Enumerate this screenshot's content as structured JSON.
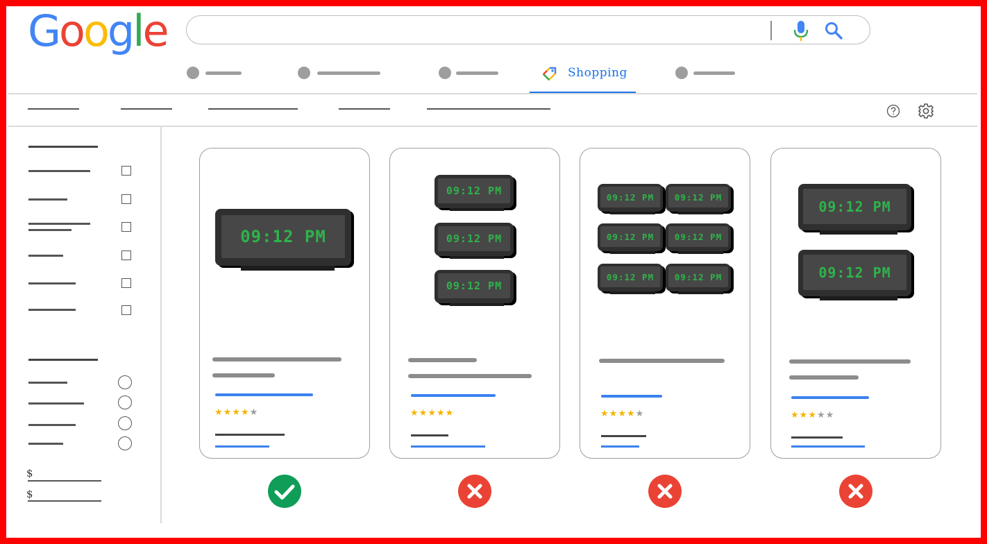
{
  "logo": {
    "text": "Google",
    "letters": [
      "G",
      "o",
      "o",
      "g",
      "l",
      "e"
    ],
    "colors": [
      "#4285F4",
      "#EA4335",
      "#FBBC05",
      "#4285F4",
      "#34A853",
      "#EA4335"
    ]
  },
  "search": {
    "value": "",
    "placeholder": "",
    "mic_icon": "mic-icon",
    "search_icon": "search-icon"
  },
  "tabs": {
    "active": {
      "label": "Shopping",
      "icon": "price-tag-icon"
    }
  },
  "toolbar": {
    "help_icon": "help-icon",
    "settings_icon": "settings-gear-icon"
  },
  "sidebar": {
    "price_symbols": [
      "$",
      "$"
    ]
  },
  "products": [
    {
      "clock_text": "09:12 PM",
      "clock_count": 1,
      "rating": 4,
      "verdict": "correct"
    },
    {
      "clock_text": "09:12 PM",
      "clock_count": 3,
      "rating": 5,
      "verdict": "incorrect"
    },
    {
      "clock_text": "09:12 PM",
      "clock_count": 6,
      "rating": 4,
      "verdict": "incorrect"
    },
    {
      "clock_text": "09:12 PM",
      "clock_count": 2,
      "rating": 3,
      "verdict": "incorrect"
    }
  ],
  "colors": {
    "frame": "#ff0000",
    "accent": "#1a73e8",
    "star": "#f6b400",
    "correct": "#0f9d58",
    "incorrect": "#ea4335",
    "clock_digits": "#2fb34a"
  }
}
